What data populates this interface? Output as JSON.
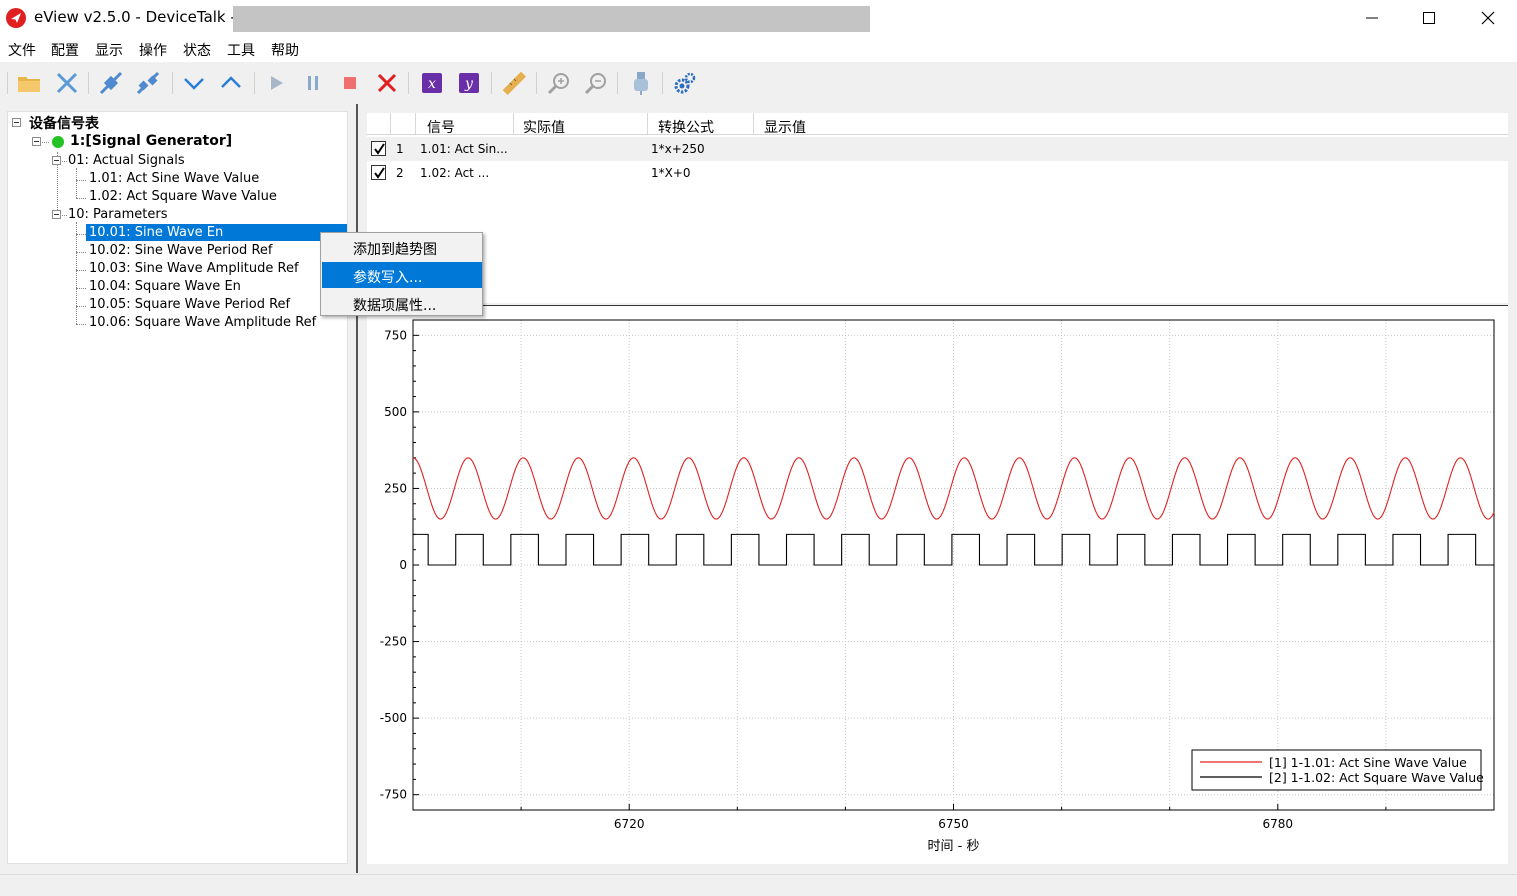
{
  "window": {
    "title": "eView v2.5.0 - DeviceTalk  -"
  },
  "menu": [
    "文件",
    "配置",
    "显示",
    "操作",
    "状态",
    "工具",
    "帮助"
  ],
  "toolbar": {
    "buttons": [
      "open-folder-icon",
      "close-x-icon",
      "connect-icon",
      "disconnect-icon",
      "chevron-down-icon",
      "chevron-up-icon",
      "play-icon",
      "pause-icon",
      "stop-icon",
      "delete-icon",
      "x-axis-icon",
      "y-axis-icon",
      "ruler-icon",
      "zoom-in-icon",
      "zoom-out-icon",
      "usb-icon",
      "settings-icon"
    ]
  },
  "tree": {
    "root": "设备信号表",
    "device": "1:[Signal Generator]",
    "group1": "01: Actual Signals",
    "group1_items": [
      "1.01: Act Sine Wave Value",
      "1.02: Act Square Wave Value"
    ],
    "group2": "10: Parameters",
    "group2_items": [
      "10.01: Sine Wave En",
      "10.02: Sine Wave Period Ref",
      "10.03: Sine Wave Amplitude Ref",
      "10.04: Square Wave En",
      "10.05: Square Wave Period Ref",
      "10.06: Square Wave Amplitude Ref"
    ],
    "selected_index": 0
  },
  "context_menu": {
    "items": [
      "添加到趋势图",
      "参数写入...",
      "数据项属性..."
    ],
    "highlighted_index": 1
  },
  "grid": {
    "headers": [
      "信号",
      "实际值",
      "转换公式",
      "显示值"
    ],
    "rows": [
      {
        "checked": true,
        "index": "1",
        "signal": "1.01: Act Sin...",
        "actual": "",
        "formula": "1*x+250",
        "display": ""
      },
      {
        "checked": true,
        "index": "2",
        "signal": "1.02: Act ...",
        "actual": "",
        "formula": "1*X+0",
        "display": ""
      }
    ]
  },
  "chart_data": {
    "type": "line",
    "xlabel": "时间 - 秒",
    "ylabel": "",
    "xlim": [
      6700,
      6800
    ],
    "ylim": [
      -800,
      800
    ],
    "x_ticks": [
      6720,
      6750,
      6780
    ],
    "y_ticks": [
      750,
      500,
      250,
      0,
      -250,
      -500,
      -750
    ],
    "grid": true,
    "legend_position": "bottom-right",
    "series": [
      {
        "name": "[1] 1-1.01: Act Sine Wave Value",
        "color": "#e02020",
        "shape": "sine",
        "center": 250,
        "amplitude": 100,
        "period": 5.1,
        "cycles_visible": 20
      },
      {
        "name": "[2] 1-1.02: Act Square Wave Value",
        "color": "#000000",
        "shape": "square",
        "low": 0,
        "high": 100,
        "period": 5.1,
        "cycles_visible": 20
      }
    ]
  }
}
